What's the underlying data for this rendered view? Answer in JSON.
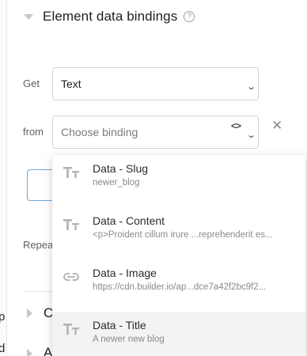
{
  "section": {
    "title": "Element data bindings",
    "help_glyph": "?"
  },
  "get": {
    "label": "Get",
    "value": "Text"
  },
  "from": {
    "label": "from",
    "placeholder": "Choose binding",
    "code_glyph": "<>",
    "close_glyph": "✕"
  },
  "repeat": {
    "label": "Repea"
  },
  "left_edge": {
    "stray_1": "p",
    "stray_2": "d"
  },
  "collapsed": {
    "first_letter": "C",
    "second_letter": "A"
  },
  "dropdown": {
    "options": [
      {
        "title": "Data - Slug",
        "subtitle": "newer_blog",
        "icon": "text-type-icon",
        "highlighted": false
      },
      {
        "title": "Data - Content",
        "subtitle": "<p>Proident cillum irure ...reprehenderit es...",
        "icon": "text-type-icon",
        "highlighted": false
      },
      {
        "title": "Data - Image",
        "subtitle": "https://cdn.builder.io/ap...dce7a42f2bc9f2...",
        "icon": "link-icon",
        "highlighted": false
      },
      {
        "title": "Data - Title",
        "subtitle": "A newer new blog",
        "icon": "text-type-icon",
        "highlighted": true
      }
    ]
  },
  "colors": {
    "accent_outline": "#6fa6dc",
    "highlight_bg": "#f3f3f3",
    "icon_gray": "#b5b5b5"
  }
}
